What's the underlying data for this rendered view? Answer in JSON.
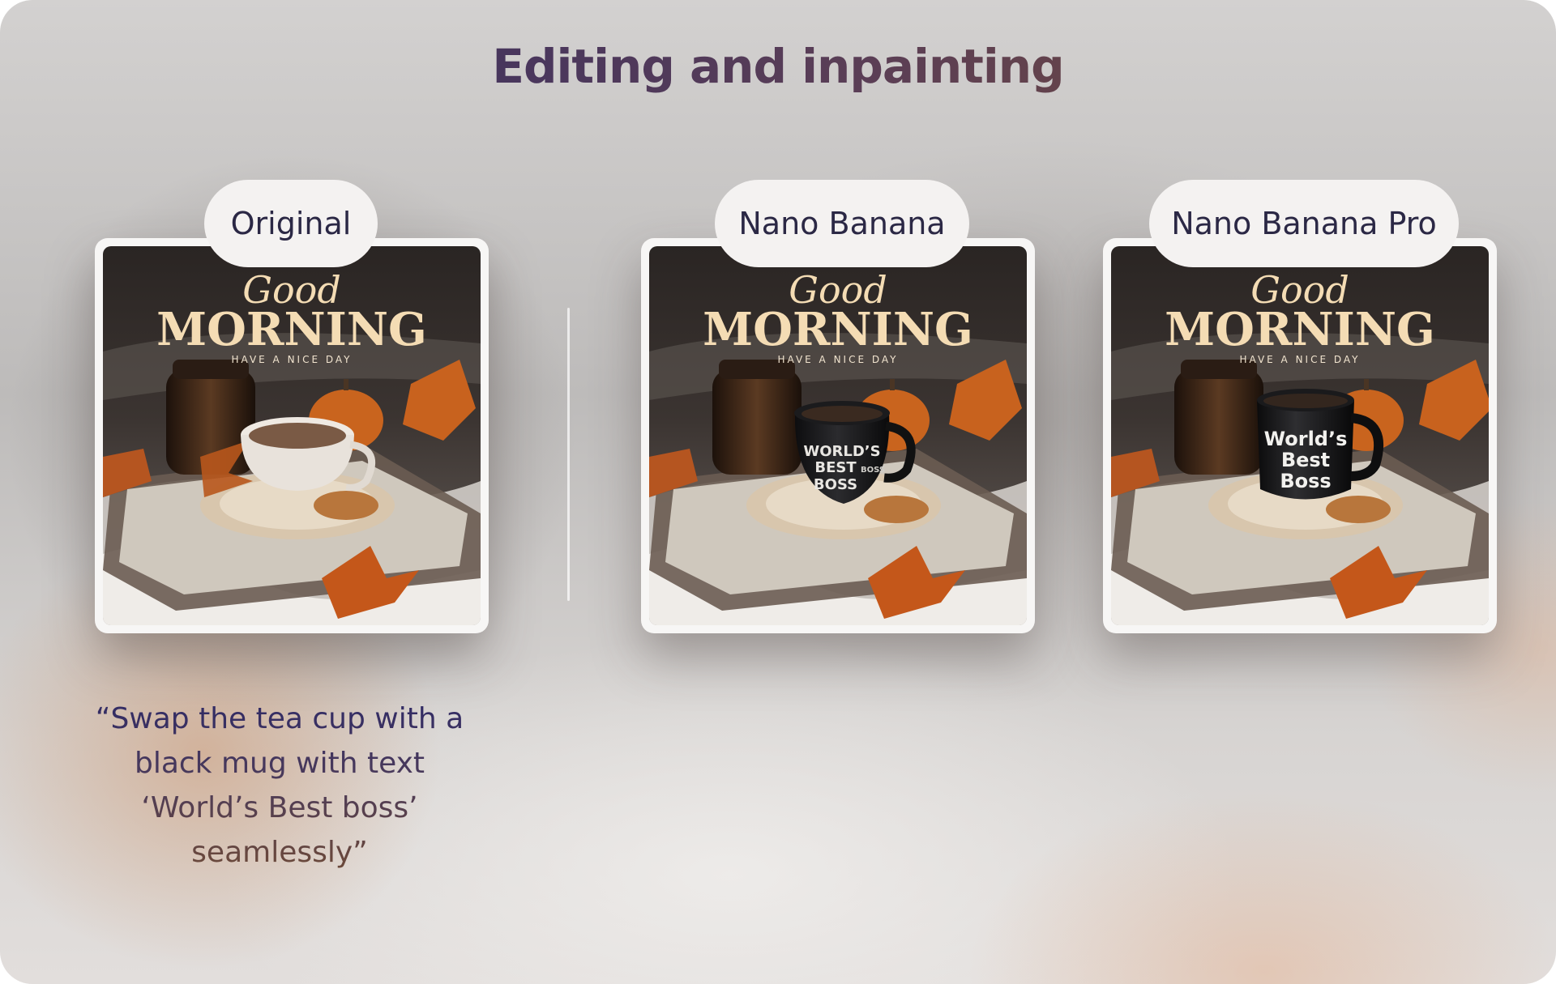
{
  "page": {
    "title": "Editing and inpainting",
    "prompt": "“Swap the tea cup with a black mug with text ‘World’s Best boss’ seamlessly”"
  },
  "panels": [
    {
      "label": "Original",
      "image": {
        "greeting_script": "Good",
        "greeting": "MORNING",
        "tagline": "HAVE A NICE DAY",
        "cup": "white-tea-cup"
      }
    },
    {
      "label": "Nano Banana",
      "image": {
        "greeting_script": "Good",
        "greeting": "MORNING",
        "tagline": "HAVE A NICE DAY",
        "cup": "black-mug",
        "mug_lines": [
          "WORLD’S",
          "BEST",
          "BOSS"
        ],
        "mug_extra": "BOSS"
      }
    },
    {
      "label": "Nano Banana Pro",
      "image": {
        "greeting_script": "Good",
        "greeting": "MORNING",
        "tagline": "HAVE A NICE DAY",
        "cup": "black-mug",
        "mug_lines": [
          "World’s",
          "Best",
          "Boss"
        ]
      }
    }
  ],
  "colors": {
    "title_start": "#2f2a66",
    "title_end": "#7a4e34",
    "pill_bg": "#f4f2f1",
    "card_frame": "#f7f6f5",
    "headline_cream": "#f4dcb4",
    "leaf_orange": "#c8621e"
  }
}
